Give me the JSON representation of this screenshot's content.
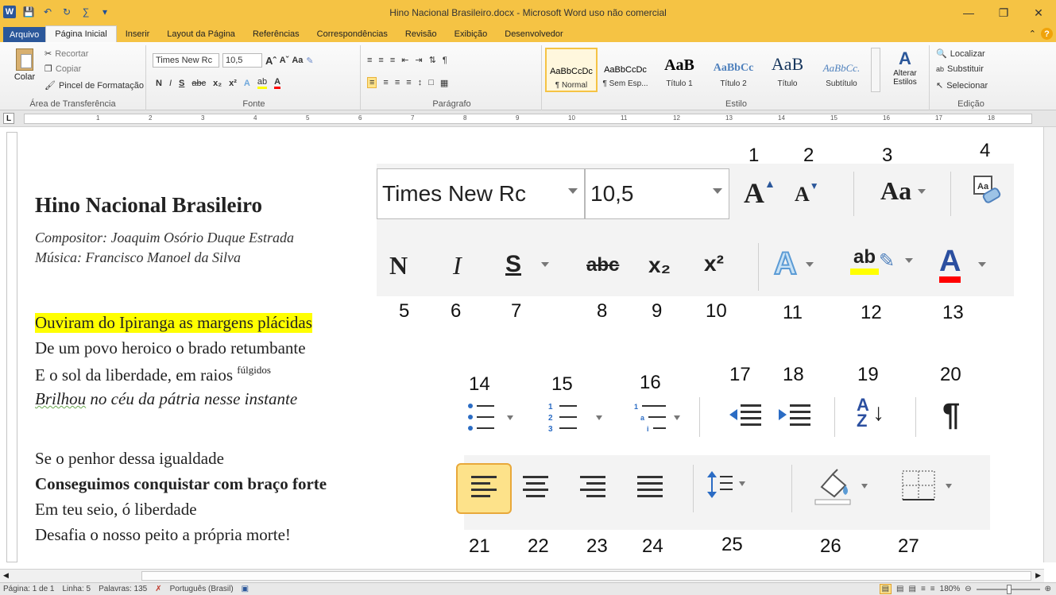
{
  "window": {
    "title": "Hino Nacional Brasileiro.docx - Microsoft Word uso não comercial",
    "minimize": "—",
    "restore": "❐",
    "close": "✕"
  },
  "tabs": [
    {
      "label": "Arquivo"
    },
    {
      "label": "Página Inicial"
    },
    {
      "label": "Inserir"
    },
    {
      "label": "Layout da Página"
    },
    {
      "label": "Referências"
    },
    {
      "label": "Correspondências"
    },
    {
      "label": "Revisão"
    },
    {
      "label": "Exibição"
    },
    {
      "label": "Desenvolvedor"
    }
  ],
  "ribbon": {
    "clipboard": {
      "paste": "Colar",
      "cut": "Recortar",
      "copy": "Copiar",
      "format_painter": "Pincel de Formatação",
      "label": "Área de Transferência"
    },
    "font": {
      "name": "Times New Rc",
      "size": "10,5",
      "bold": "N",
      "italic": "I",
      "underline": "S",
      "strike": "abc",
      "sub": "x₂",
      "sup": "x²",
      "case": "Aa",
      "label": "Fonte"
    },
    "paragraph": {
      "label": "Parágrafo"
    },
    "styles": {
      "items": [
        {
          "sample": "AaBbCcDc",
          "name": "¶ Normal"
        },
        {
          "sample": "AaBbCcDc",
          "name": "¶ Sem Esp..."
        },
        {
          "sample": "AaB",
          "name": "Título 1"
        },
        {
          "sample": "AaBbCc",
          "name": "Título 2"
        },
        {
          "sample": "AaB",
          "name": "Título"
        },
        {
          "sample": "AaBbCc.",
          "name": "Subtítulo"
        }
      ],
      "change": "Alterar Estilos",
      "label": "Estilo"
    },
    "editing": {
      "find": "Localizar",
      "replace": "Substituir",
      "select": "Selecionar",
      "label": "Edição"
    }
  },
  "ruler": {
    "numbers": [
      "1",
      "2",
      "3",
      "4",
      "5",
      "6",
      "7",
      "8",
      "9",
      "10",
      "11",
      "12",
      "13",
      "14",
      "15",
      "16",
      "17",
      "18"
    ]
  },
  "document": {
    "title": "Hino Nacional Brasileiro",
    "composer": "Compositor: Joaquim Osório Duque Estrada",
    "music": "Música: Francisco Manoel da Silva",
    "stanza1": [
      "Ouviram do Ipiranga as margens plácidas",
      "De um povo heroico o brado retumbante",
      "E o sol da liberdade, em raios",
      "fúlgidos",
      "Brilhou",
      "no céu da pátria nesse instante"
    ],
    "stanza2": [
      "Se o penhor dessa igualdade",
      "Conseguimos conquistar com braço forte",
      "Em teu seio, ó liberdade",
      "Desafia o nosso peito a própria morte!"
    ]
  },
  "zoom_panel": {
    "font_name": "Times New Rc",
    "font_size": "10,5",
    "labels": [
      "1",
      "2",
      "3",
      "4",
      "5",
      "6",
      "7",
      "8",
      "9",
      "10",
      "11",
      "12",
      "13",
      "14",
      "15",
      "16",
      "17",
      "18",
      "19",
      "20",
      "21",
      "22",
      "23",
      "24",
      "25",
      "26",
      "27"
    ],
    "glyphs": {
      "grow": "A",
      "shrink": "A",
      "case": "Aa",
      "bold": "N",
      "italic": "I",
      "underline": "S",
      "strike": "abc",
      "sub": "x₂",
      "sup": "x²",
      "effects": "A",
      "highlight": "ab",
      "font_color": "A",
      "sort": "A Z",
      "pilcrow": "¶"
    },
    "colors": {
      "highlight": "#ffff00",
      "font_color": "#ff0000",
      "accent": "#2b579a"
    }
  },
  "status": {
    "page": "Página: 1 de 1",
    "line": "Linha: 5",
    "words": "Palavras: 135",
    "language": "Português (Brasil)",
    "zoom": "180%"
  }
}
